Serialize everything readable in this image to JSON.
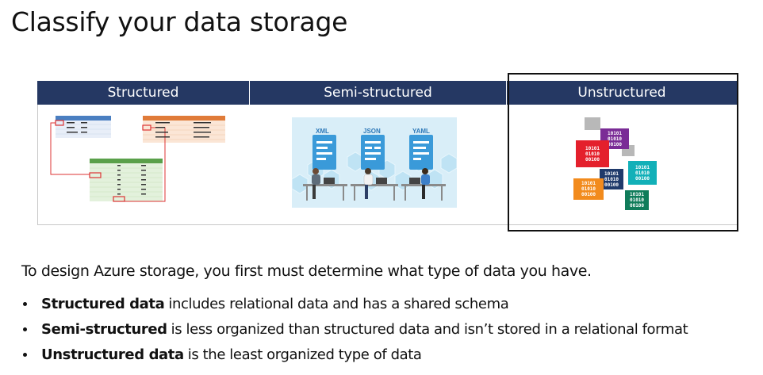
{
  "title": "Classify your data storage",
  "panels": [
    {
      "label": "Structured"
    },
    {
      "label": "Semi-structured"
    },
    {
      "label": "Unstructured"
    }
  ],
  "semi_illustration": {
    "doc_labels": [
      "XML",
      "JSON",
      "YAML"
    ]
  },
  "unstructured_illustration": {
    "block_text": "10101\n01010\n00100"
  },
  "intro": "To design Azure storage, you first must determine what type of data you have.",
  "bullets": [
    {
      "bold": "Structured data",
      "rest": "includes relational data and has a shared schema"
    },
    {
      "bold": "Semi-structured",
      "rest": "is less organized than structured data and isn’t stored in a relational format"
    },
    {
      "bold": "Unstructured data",
      "rest": "is the least organized type of data"
    }
  ],
  "colors": {
    "header_bg": "#253863",
    "accent_red": "#d33333",
    "semi_bg": "#d9eef8"
  }
}
